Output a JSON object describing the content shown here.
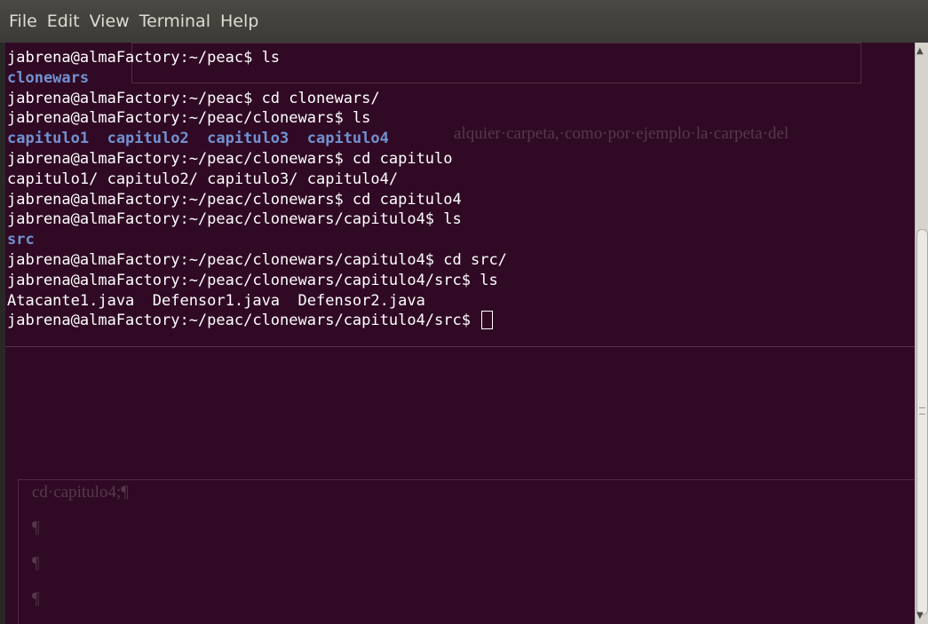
{
  "menubar": {
    "items": [
      "File",
      "Edit",
      "View",
      "Terminal",
      "Help"
    ]
  },
  "terminal": {
    "lines": [
      {
        "text": "jabrena@almaFactory:~/peac$ ls",
        "style": "normal"
      },
      {
        "text": "clonewars",
        "style": "dir"
      },
      {
        "text": "jabrena@almaFactory:~/peac$ cd clonewars/",
        "style": "normal"
      },
      {
        "text": "jabrena@almaFactory:~/peac/clonewars$ ls",
        "style": "normal"
      },
      {
        "text": "capitulo1  capitulo2  capitulo3  capitulo4",
        "style": "dir"
      },
      {
        "text": "jabrena@almaFactory:~/peac/clonewars$ cd capitulo",
        "style": "normal"
      },
      {
        "text": "capitulo1/ capitulo2/ capitulo3/ capitulo4/",
        "style": "normal"
      },
      {
        "text": "jabrena@almaFactory:~/peac/clonewars$ cd capitulo4",
        "style": "normal"
      },
      {
        "text": "jabrena@almaFactory:~/peac/clonewars/capitulo4$ ls",
        "style": "normal"
      },
      {
        "text": "src",
        "style": "dir"
      },
      {
        "text": "jabrena@almaFactory:~/peac/clonewars/capitulo4$ cd src/",
        "style": "normal"
      },
      {
        "text": "jabrena@almaFactory:~/peac/clonewars/capitulo4/src$ ls",
        "style": "normal"
      },
      {
        "text": "Atacante1.java  Defensor1.java  Defensor2.java",
        "style": "normal"
      },
      {
        "text": "jabrena@almaFactory:~/peac/clonewars/capitulo4/src$ ",
        "style": "prompt"
      }
    ]
  },
  "ghost": {
    "text1": "alquier·carpeta,·como·por·ejemplo·la·carpeta·del",
    "text2": "cd·capitulo4;¶",
    "pilcrow": "¶"
  },
  "colors": {
    "background": "#300a24",
    "text": "#ffffff",
    "directory": "#7291d2",
    "menubar": "#3c3b37"
  },
  "icons": {
    "scroll_up": "arrow-up-icon",
    "scroll_down": "arrow-down-icon"
  }
}
